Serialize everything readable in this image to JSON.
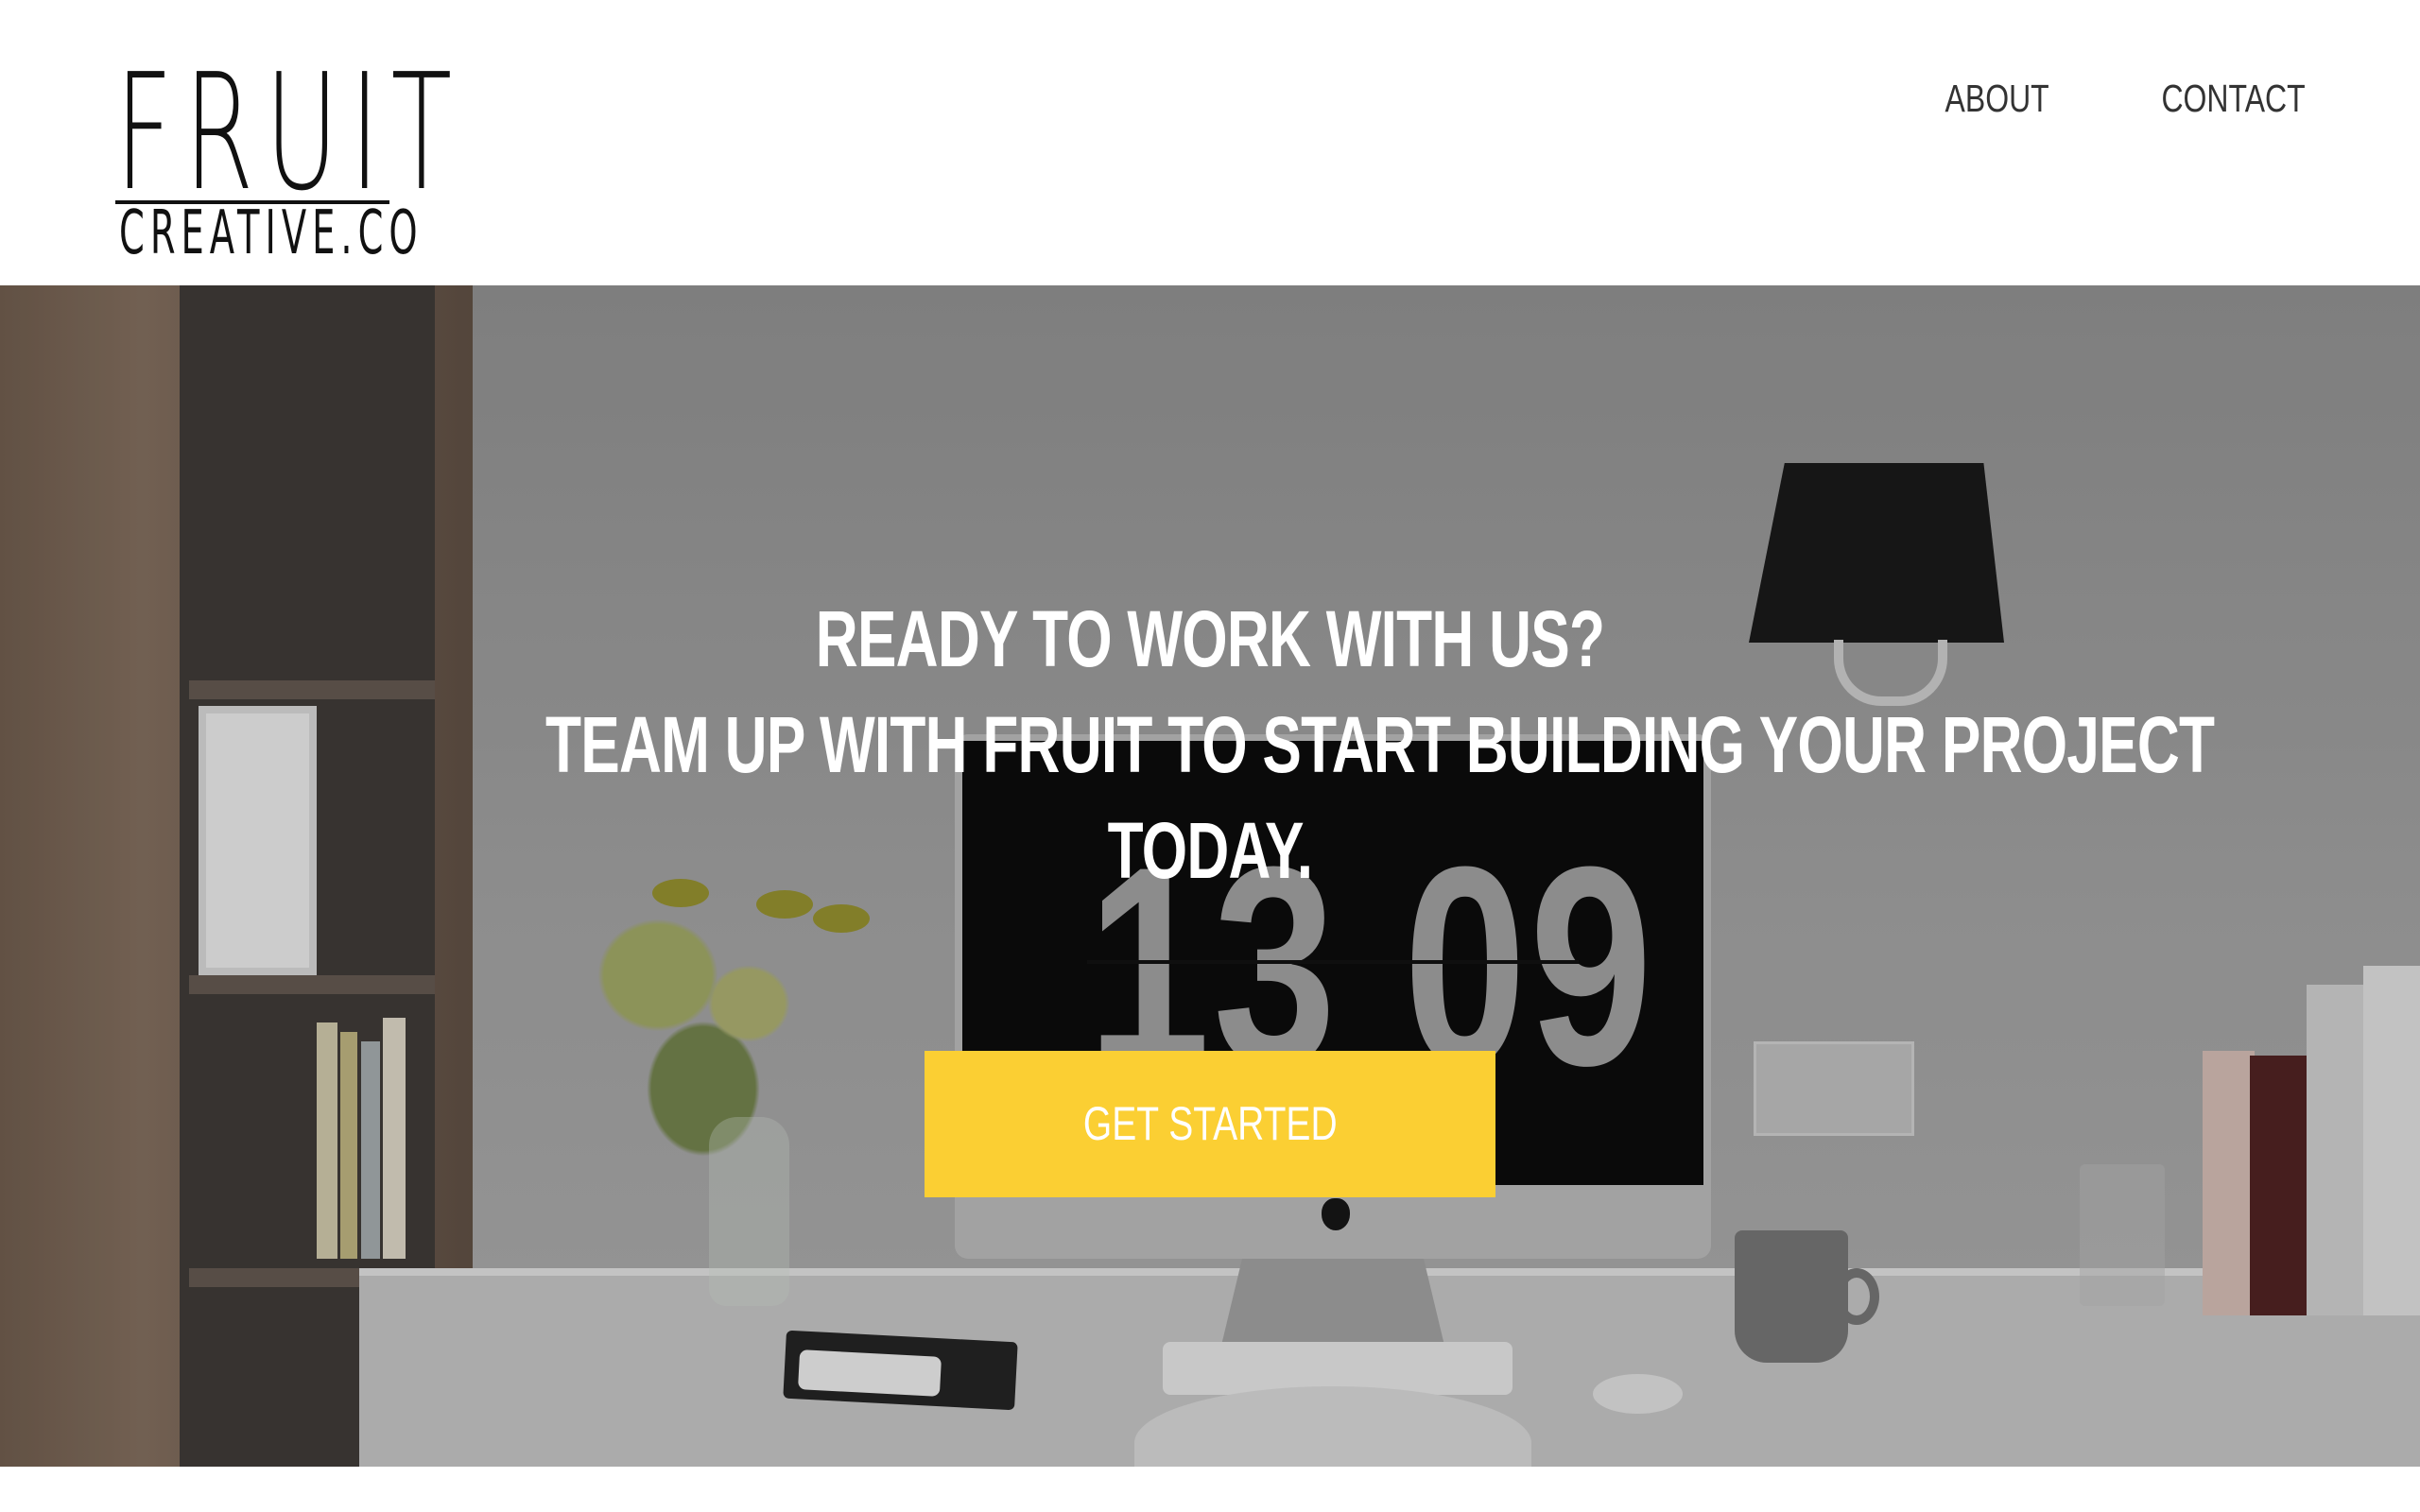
{
  "brand": {
    "logo_top": "FRUIT",
    "logo_bottom": "CREATIVE.CO"
  },
  "nav": {
    "items": [
      {
        "label": "ABOUT"
      },
      {
        "label": "CONTACT"
      }
    ]
  },
  "hero": {
    "headline_lines": [
      "READY TO WORK WITH US?",
      "TEAM UP WITH FRUIT TO START BUILDING YOUR PROJECT",
      "TODAY."
    ],
    "background_clock": "13 09",
    "cta_label": "GET STARTED"
  },
  "colors": {
    "accent": "#fbcf33",
    "text_dark": "#333333",
    "header_bg": "#ffffff",
    "hero_text": "#ffffff"
  },
  "icons": {
    "background_photo": "office-desk-photo",
    "apple_logo": "apple-logo-icon"
  }
}
